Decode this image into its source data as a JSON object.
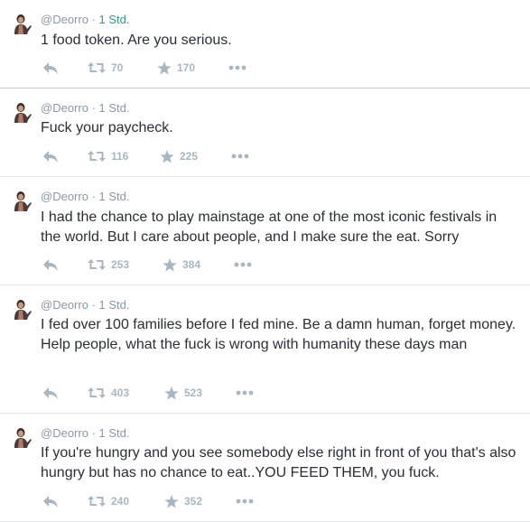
{
  "colors": {
    "text": "#292f33",
    "meta": "#8899a6",
    "action_icon": "#a8b6c2",
    "divider": "#e1e8ed",
    "live_time": "#2b9c8f"
  },
  "icons": {
    "reply": "reply-icon",
    "retweet": "retweet-icon",
    "favorite": "star-icon",
    "more": "more-icon"
  },
  "tweets": [
    {
      "handle": "@Deorro",
      "separator": "·",
      "time": "1 Std.",
      "text": "1 food token. Are you serious.",
      "retweets": "70",
      "favorites": "170"
    },
    {
      "handle": "@Deorro",
      "separator": "·",
      "time": "1 Std.",
      "text": "Fuck your paycheck.",
      "retweets": "116",
      "favorites": "225"
    },
    {
      "handle": "@Deorro",
      "separator": "·",
      "time": "1 Std.",
      "text": "I had the chance to play mainstage at one of the most iconic festivals in the world. But I care about people, and I make sure the eat. Sorry",
      "retweets": "253",
      "favorites": "384"
    },
    {
      "handle": "@Deorro",
      "separator": "·",
      "time": "1 Std.",
      "text": "I fed over 100 families before I fed mine. Be a damn human, forget money. Help people, what the fuck is wrong with humanity these days man",
      "retweets": "403",
      "favorites": "523"
    },
    {
      "handle": "@Deorro",
      "separator": "·",
      "time": "1 Std.",
      "text": "If you're hungry and you see somebody else right in front of you that's also hungry but has no chance to eat..YOU FEED THEM, you fuck.",
      "retweets": "240",
      "favorites": "352"
    }
  ]
}
